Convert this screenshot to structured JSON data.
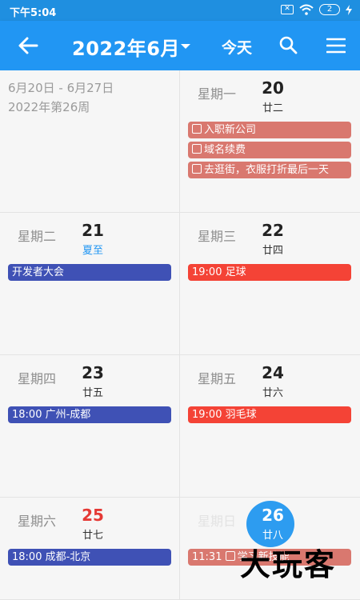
{
  "status_bar": {
    "time": "下午5:04",
    "battery": "2"
  },
  "app_bar": {
    "title": "2022年6月",
    "today_label": "今天"
  },
  "week_summary": {
    "range": "6月20日 - 6月27日",
    "week": "2022年第26周"
  },
  "days": [
    {
      "weekday": "星期一",
      "date": "20",
      "lunar": "廿二",
      "events": [
        {
          "text": "入职新公司"
        },
        {
          "text": "域名续费"
        },
        {
          "text": "去逛街，衣服打折最后一天"
        }
      ]
    },
    {
      "weekday": "星期二",
      "date": "21",
      "lunar": "夏至",
      "events": [
        {
          "text": "开发者大会"
        }
      ]
    },
    {
      "weekday": "星期三",
      "date": "22",
      "lunar": "廿四",
      "events": [
        {
          "text": "19:00 足球"
        }
      ]
    },
    {
      "weekday": "星期四",
      "date": "23",
      "lunar": "廿五",
      "events": [
        {
          "text": "18:00 广州-成都"
        }
      ]
    },
    {
      "weekday": "星期五",
      "date": "24",
      "lunar": "廿六",
      "events": [
        {
          "text": "19:00 羽毛球"
        }
      ]
    },
    {
      "weekday": "星期六",
      "date": "25",
      "lunar": "廿七",
      "events": [
        {
          "text": "18:00 成都-北京"
        }
      ]
    },
    {
      "weekday": "星期日",
      "date": "26",
      "lunar": "廿八",
      "events": [
        {
          "time": "11:31",
          "text": "学习新技能"
        }
      ]
    }
  ],
  "watermark": "大玩客",
  "colors": {
    "primary": "#2196f3",
    "event_blue": "#3f51b5",
    "event_red": "#f44336",
    "task_red": "#d9786f",
    "weekend_red": "#e53935"
  }
}
